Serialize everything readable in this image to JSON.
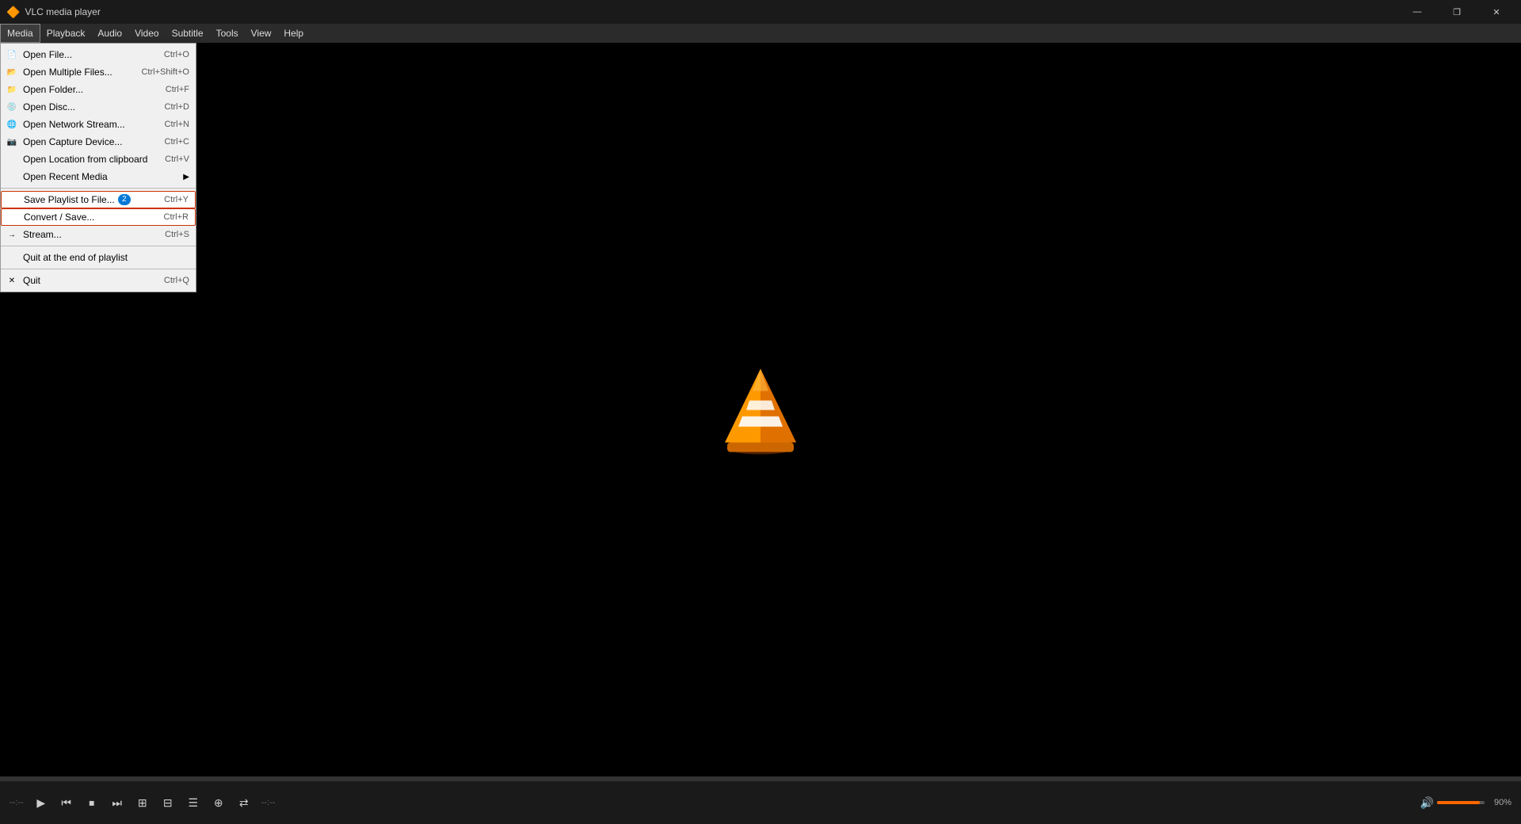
{
  "titlebar": {
    "title": "VLC media player",
    "controls": {
      "minimize": "—",
      "maximize": "❐",
      "close": "✕"
    }
  },
  "menubar": {
    "items": [
      {
        "id": "media",
        "label": "Media",
        "active": true
      },
      {
        "id": "playback",
        "label": "Playback"
      },
      {
        "id": "audio",
        "label": "Audio"
      },
      {
        "id": "video",
        "label": "Video"
      },
      {
        "id": "subtitle",
        "label": "Subtitle"
      },
      {
        "id": "tools",
        "label": "Tools"
      },
      {
        "id": "view",
        "label": "View"
      },
      {
        "id": "help",
        "label": "Help"
      }
    ]
  },
  "dropdown": {
    "items": [
      {
        "id": "open-file",
        "label": "Open File...",
        "shortcut": "Ctrl+O",
        "icon": "📄",
        "separator": false
      },
      {
        "id": "open-multiple",
        "label": "Open Multiple Files...",
        "shortcut": "Ctrl+Shift+O",
        "icon": "📂",
        "separator": false
      },
      {
        "id": "open-folder",
        "label": "Open Folder...",
        "shortcut": "Ctrl+F",
        "icon": "📁",
        "separator": false
      },
      {
        "id": "open-disc",
        "label": "Open Disc...",
        "shortcut": "Ctrl+D",
        "icon": "💿",
        "separator": false
      },
      {
        "id": "open-network",
        "label": "Open Network Stream...",
        "shortcut": "Ctrl+N",
        "icon": "🌐",
        "separator": false
      },
      {
        "id": "open-capture",
        "label": "Open Capture Device...",
        "shortcut": "Ctrl+C",
        "icon": "📷",
        "separator": false
      },
      {
        "id": "open-location",
        "label": "Open Location from clipboard",
        "shortcut": "Ctrl+V",
        "icon": "",
        "separator": false
      },
      {
        "id": "open-recent",
        "label": "Open Recent Media",
        "shortcut": "",
        "icon": "",
        "arrow": "▶",
        "separator": false
      },
      {
        "id": "sep1",
        "separator": true
      },
      {
        "id": "save-playlist",
        "label": "Save Playlist to File...",
        "shortcut": "Ctrl+Y",
        "icon": "",
        "badge": "2",
        "separator": false
      },
      {
        "id": "convert-save",
        "label": "Convert / Save...",
        "shortcut": "Ctrl+R",
        "icon": "",
        "separator": false,
        "highlight": "red"
      },
      {
        "id": "stream",
        "label": "Stream...",
        "shortcut": "Ctrl+S",
        "icon": "📡",
        "separator": false
      },
      {
        "id": "sep2",
        "separator": true
      },
      {
        "id": "quit-end",
        "label": "Quit at the end of playlist",
        "shortcut": "",
        "icon": "",
        "separator": false
      },
      {
        "id": "sep3",
        "separator": true
      },
      {
        "id": "quit",
        "label": "Quit",
        "shortcut": "Ctrl+Q",
        "icon": "",
        "separator": false
      }
    ]
  },
  "controls": {
    "play": "▶",
    "prev": "⏮",
    "stop": "⏹",
    "next": "⏭",
    "frame": "⊞",
    "toggle": "⊟",
    "playlist": "☰",
    "ext": "⊕",
    "shuffle": "⇄",
    "volume_label": "90%",
    "time_left": "--:--",
    "time_right": "--:--"
  },
  "colors": {
    "accent": "#ff6600",
    "highlight_red": "#cc3300",
    "bg": "#000000",
    "menubar_bg": "#2b2b2b",
    "dropdown_bg": "#f0f0f0"
  }
}
